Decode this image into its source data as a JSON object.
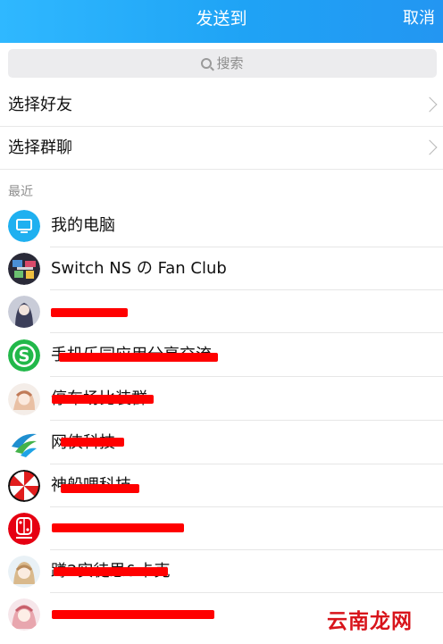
{
  "header": {
    "title": "发送到",
    "cancel": "取消"
  },
  "search": {
    "placeholder": "搜索"
  },
  "nav": {
    "friends": "选择好友",
    "groups": "选择群聊"
  },
  "recent_label": "最近",
  "contacts": [
    {
      "name": "我的电脑",
      "icon": "computer-icon",
      "redacted": false
    },
    {
      "name": "Switch NS の Fan Club",
      "icon": "group-avatar",
      "redacted": false
    },
    {
      "name": "",
      "icon": "user-avatar",
      "redacted": true
    },
    {
      "name": "手机乐园应用分享交流",
      "icon": "s-logo-icon",
      "redacted": true
    },
    {
      "name": "停车场比装群",
      "icon": "user-avatar",
      "redacted": true
    },
    {
      "name": "网侠科技",
      "icon": "leaf-logo-icon",
      "redacted": true
    },
    {
      "name": "神船哩科技",
      "icon": "umbrella-logo-icon",
      "redacted": true
    },
    {
      "name": "",
      "icon": "nintendo-switch-icon",
      "redacted": true
    },
    {
      "name": "蹲2实徒思&卡克",
      "icon": "user-avatar",
      "redacted": true
    },
    {
      "name": "",
      "icon": "user-avatar",
      "redacted": true
    }
  ],
  "colors": {
    "header": "#1fa3f5",
    "redaction": "#ff0000",
    "switch_red": "#e60012"
  },
  "watermark": "云南龙网"
}
